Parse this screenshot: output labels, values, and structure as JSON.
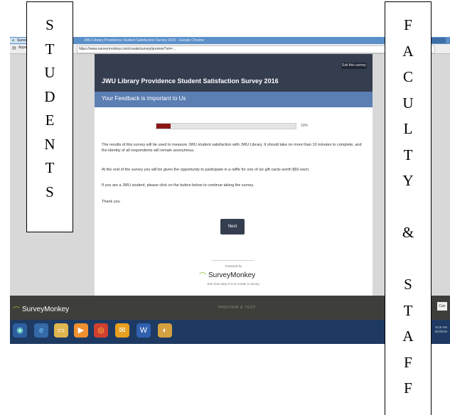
{
  "browser": {
    "tab_label": "SurveyMonkey",
    "window_title": "JWU Library Providence Student Satisfaction Survey 2016 - Google Chrome",
    "url": "https://www.surveymonkey.com/create/survey/preview?sm=...",
    "bookmark_label": "Apps"
  },
  "survey": {
    "exit_label": "Exit this survey",
    "title": "JWU Library Providence Student Satisfaction Survey 2016",
    "page_title": "Your Feedback is Important to Us",
    "progress": {
      "percent": 10,
      "label": "10%"
    },
    "paragraphs": [
      "The results of this survey will be used to measure JWU student satisfaction with JWU Library. It should take no more than 10 minutes to complete, and the identity of all respondents will remain anonymous.",
      "At the end of the survey you will be given the opportunity to participate in a raffle for one of six gift cards worth $50 each.",
      "If you are a JWU student, please click on the button below to continue taking the survey.",
      "Thank you"
    ],
    "next_label": "Next",
    "powered_by": "Powered by",
    "brand": "SurveyMonkey",
    "promo": "See how easy it is to create a survey."
  },
  "editor_bar": {
    "brand": "SurveyMonkey",
    "mode": "PREVIEW & TEST",
    "right_button": "Can"
  },
  "taskbar": {
    "tray_text": "8:15 AM\n3/1/2016"
  },
  "annotations": {
    "students": [
      "S",
      "T",
      "U",
      "D",
      "E",
      "N",
      "T",
      "S"
    ],
    "faculty": [
      "F",
      "A",
      "C",
      "U",
      "L",
      "T",
      "Y",
      "",
      "&",
      "",
      "S",
      "T",
      "A",
      "F",
      "F"
    ]
  },
  "colors": {
    "survey_header": "#353e4f",
    "page_title_bar": "#5b7eb3",
    "progress_fill": "#8a1818",
    "brand_green": "#8cbf2d",
    "editor_bar": "#3e3f3a",
    "taskbar": "#1e3a62"
  },
  "icons": {
    "taskbar": [
      "windows-start-icon",
      "ie-icon",
      "folder-icon",
      "media-icon",
      "chrome-icon",
      "outlook-icon",
      "word-icon",
      "misc-icon"
    ]
  }
}
